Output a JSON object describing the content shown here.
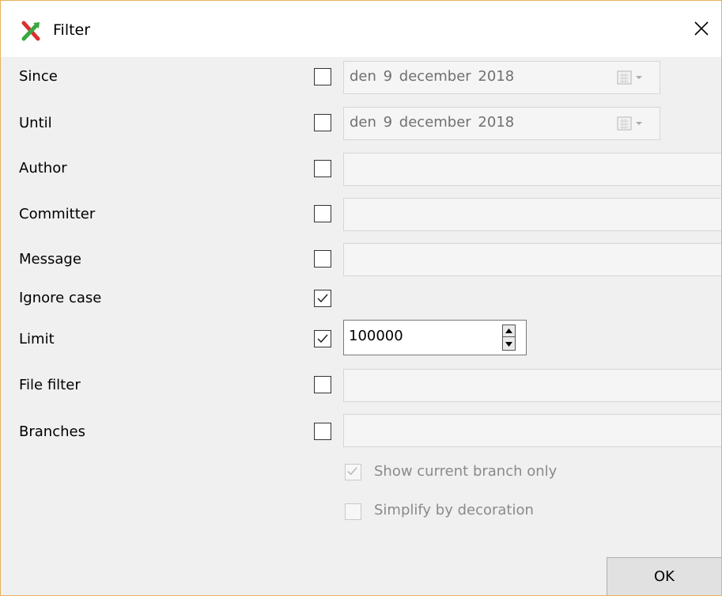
{
  "window": {
    "title": "Filter",
    "app_icon": "git-extensions-filter-icon",
    "close_icon": "close-icon"
  },
  "rows": {
    "since": {
      "label": "Since",
      "checked": false,
      "value": "den  9 december  2018"
    },
    "until": {
      "label": "Until",
      "checked": false,
      "value": "den  9 december  2018"
    },
    "author": {
      "label": "Author",
      "checked": false,
      "value": ""
    },
    "committer": {
      "label": "Committer",
      "checked": false,
      "value": ""
    },
    "message": {
      "label": "Message",
      "checked": false,
      "value": ""
    },
    "ignore_case": {
      "label": "Ignore case",
      "checked": true
    },
    "limit": {
      "label": "Limit",
      "checked": true,
      "value": "100000"
    },
    "file_filter": {
      "label": "File filter",
      "checked": false,
      "value": ""
    },
    "branches": {
      "label": "Branches",
      "checked": false,
      "value": ""
    }
  },
  "options": {
    "show_current_branch_only": {
      "label": "Show current branch only",
      "checked": true,
      "enabled": false
    },
    "simplify_by_decoration": {
      "label": "Simplify by decoration",
      "checked": false,
      "enabled": false
    }
  },
  "buttons": {
    "ok_label": "OK"
  },
  "colors": {
    "window_border": "#e6b35c",
    "dialog_bg": "#f0f0f0",
    "titlebar_bg": "#ffffff"
  }
}
